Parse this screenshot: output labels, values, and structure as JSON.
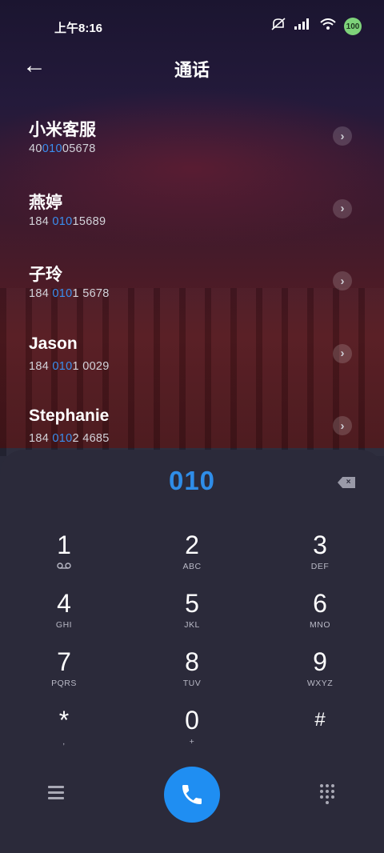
{
  "status": {
    "time": "上午8:16",
    "battery": "100"
  },
  "header": {
    "title": "通话",
    "back_glyph": "←"
  },
  "contacts": [
    {
      "name": "小米客服",
      "num_pre": "40",
      "num_hl": "010",
      "num_post": "05678"
    },
    {
      "name": "燕婷",
      "num_pre": "184 ",
      "num_hl": "010",
      "num_post": "15689"
    },
    {
      "name": "子玲",
      "num_pre": "184 ",
      "num_hl": "010",
      "num_post": "1 5678"
    },
    {
      "name": "Jason",
      "num_pre": "184 ",
      "num_hl": "010",
      "num_post": "1 0029"
    },
    {
      "name": "Stephanie",
      "num_pre": "184 ",
      "num_hl": "010",
      "num_post": "2 4685"
    }
  ],
  "dialpad": {
    "entry": "010",
    "keys": [
      {
        "digit": "1",
        "letters": "⌂"
      },
      {
        "digit": "2",
        "letters": "ABC"
      },
      {
        "digit": "3",
        "letters": "DEF"
      },
      {
        "digit": "4",
        "letters": "GHI"
      },
      {
        "digit": "5",
        "letters": "JKL"
      },
      {
        "digit": "6",
        "letters": "MNO"
      },
      {
        "digit": "7",
        "letters": "PQRS"
      },
      {
        "digit": "8",
        "letters": "TUV"
      },
      {
        "digit": "9",
        "letters": "WXYZ"
      },
      {
        "digit": "*",
        "letters": ","
      },
      {
        "digit": "0",
        "letters": "+"
      },
      {
        "digit": "#",
        "letters": ""
      }
    ]
  },
  "icons": {
    "back": "arrow-left-icon",
    "chevron": "chevron-right-icon",
    "backspace": "backspace-icon",
    "menu": "menu-icon",
    "call": "phone-icon",
    "dialpad": "dialpad-icon"
  },
  "colors": {
    "accent": "#1f8ef2",
    "highlight": "#3a8ff0",
    "pad_bg": "#2b2a3a"
  }
}
